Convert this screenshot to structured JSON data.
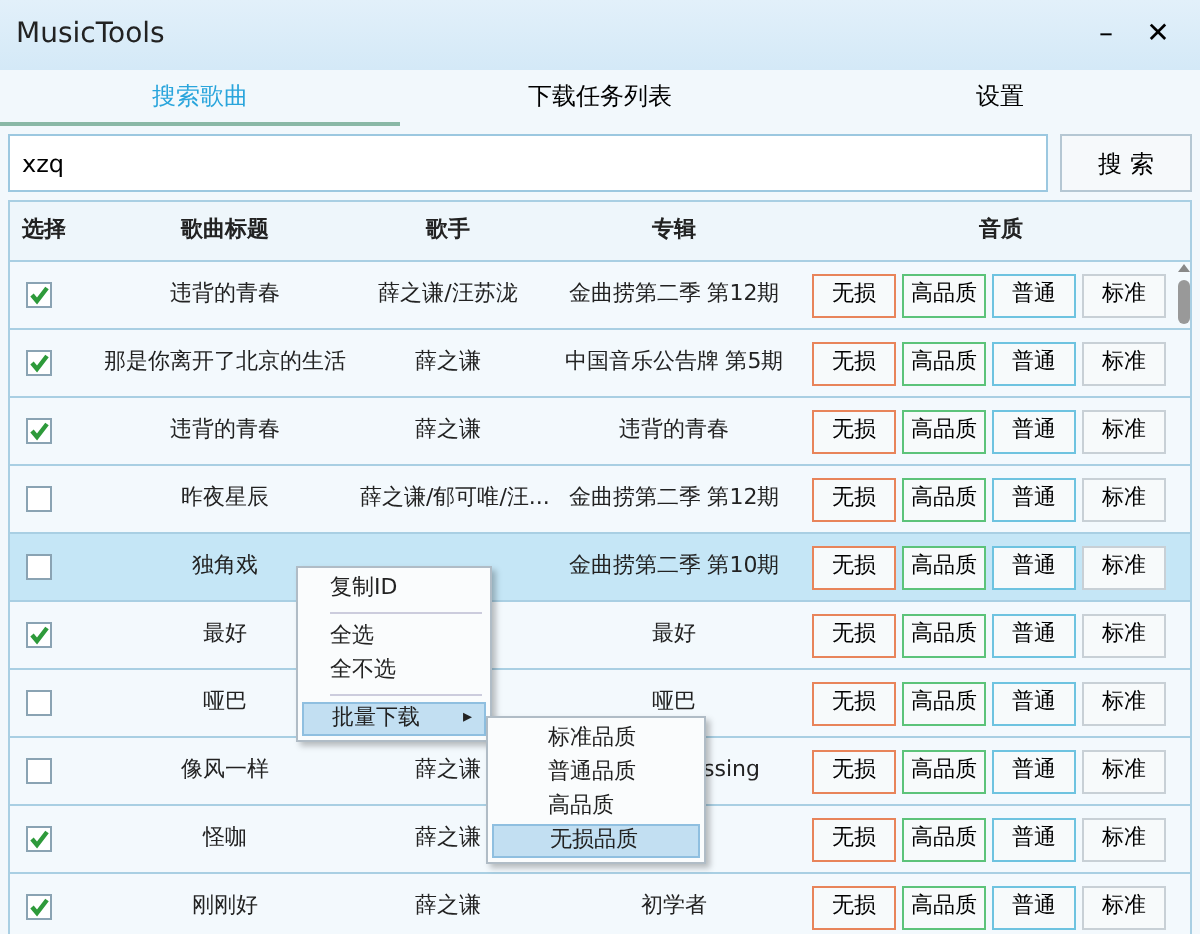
{
  "window": {
    "title": "MusicTools",
    "controls": [
      "–",
      "✕"
    ]
  },
  "tabs": [
    {
      "label": "搜索歌曲",
      "selected": true
    },
    {
      "label": "下载任务列表",
      "selected": false
    },
    {
      "label": "设置",
      "selected": false
    }
  ],
  "search": {
    "value": "xzq",
    "button": "搜 索"
  },
  "table": {
    "columns": [
      "选择",
      "歌曲标题",
      "歌手",
      "专辑",
      "音质"
    ],
    "rows": [
      {
        "kind": "full",
        "checked": true,
        "selected": false,
        "title": "违背的青春",
        "artist": "薛之谦/汪苏泷",
        "album": "金曲捞第二季 第12期",
        "quality": [
          {
            "label": "无损",
            "color": "#e8845a"
          },
          {
            "label": "高品质",
            "color": "#5cc37a"
          },
          {
            "label": "普通",
            "color": "#6ec3e0"
          },
          {
            "label": "标准",
            "color": "#c8d0d6"
          }
        ]
      },
      {
        "kind": "full",
        "checked": true,
        "selected": false,
        "title": "那是你离开了北京的生活",
        "artist": "薛之谦",
        "album": "中国音乐公告牌 第5期",
        "quality": [
          {
            "label": "无损",
            "color": "#e8845a"
          },
          {
            "label": "高品质",
            "color": "#5cc37a"
          },
          {
            "label": "普通",
            "color": "#6ec3e0"
          },
          {
            "label": "标准",
            "color": "#c8d0d6"
          }
        ]
      },
      {
        "kind": "full",
        "checked": true,
        "selected": false,
        "title": "违背的青春",
        "artist": "薛之谦",
        "album": "违背的青春",
        "quality": [
          {
            "label": "无损",
            "color": "#e8845a"
          },
          {
            "label": "高品质",
            "color": "#5cc37a"
          },
          {
            "label": "普通",
            "color": "#6ec3e0"
          },
          {
            "label": "标准",
            "color": "#c8d0d6"
          }
        ]
      },
      {
        "kind": "full",
        "checked": false,
        "selected": false,
        "title": "昨夜星辰",
        "artist": "薛之谦/郁可唯/汪...",
        "album": "金曲捞第二季 第12期",
        "quality": [
          {
            "label": "无损",
            "color": "#e8845a"
          },
          {
            "label": "高品质",
            "color": "#5cc37a"
          },
          {
            "label": "普通",
            "color": "#6ec3e0"
          },
          {
            "label": "标准",
            "color": "#c8d0d6"
          }
        ]
      },
      {
        "kind": "full",
        "checked": false,
        "selected": true,
        "title": "独角戏",
        "album": "金曲捞第二季 第10期",
        "quality": [
          {
            "label": "无损",
            "color": "#e8845a"
          },
          {
            "label": "高品质",
            "color": "#5cc37a"
          },
          {
            "label": "普通",
            "color": "#6ec3e0"
          },
          {
            "label": "标准",
            "color": "#c8d0d6"
          }
        ]
      },
      {
        "kind": "full",
        "checked": true,
        "selected": false,
        "title": "最好",
        "album": "最好",
        "quality": [
          {
            "label": "无损",
            "color": "#e8845a"
          },
          {
            "label": "高品质",
            "color": "#5cc37a"
          },
          {
            "label": "普通",
            "color": "#6ec3e0"
          },
          {
            "label": "标准",
            "color": "#c8d0d6"
          }
        ]
      },
      {
        "kind": "full",
        "checked": false,
        "selected": false,
        "title": "哑巴",
        "album": "哑巴",
        "quality": [
          {
            "label": "无损",
            "color": "#e8845a"
          },
          {
            "label": "高品质",
            "color": "#5cc37a"
          },
          {
            "label": "普通",
            "color": "#6ec3e0"
          },
          {
            "label": "标准",
            "color": "#c8d0d6"
          }
        ]
      },
      {
        "kind": "covered",
        "checked": false,
        "selected": false,
        "title": "像风一样",
        "artist": "薛之谦",
        "album": "ssing",
        "quality": [
          {
            "label": "无损",
            "color": "#e8845a"
          },
          {
            "label": "高品质",
            "color": "#5cc37a"
          },
          {
            "label": "普通",
            "color": "#6ec3e0"
          },
          {
            "label": "标准",
            "color": "#c8d0d6"
          }
        ]
      },
      {
        "kind": "full",
        "checked": true,
        "selected": false,
        "title": "怪咖",
        "artist": "薛之谦",
        "quality": [
          {
            "label": "无损",
            "color": "#e8845a"
          },
          {
            "label": "高品质",
            "color": "#5cc37a"
          },
          {
            "label": "普通",
            "color": "#6ec3e0"
          },
          {
            "label": "标准",
            "color": "#c8d0d6"
          }
        ]
      },
      {
        "kind": "full",
        "checked": true,
        "selected": false,
        "title": "刚刚好",
        "artist": "薛之谦",
        "album": "初学者",
        "quality": [
          {
            "label": "无损",
            "color": "#e8845a"
          },
          {
            "label": "高品质",
            "color": "#5cc37a"
          },
          {
            "label": "普通",
            "color": "#6ec3e0"
          },
          {
            "label": "标准",
            "color": "#c8d0d6"
          }
        ]
      }
    ]
  },
  "context_menu": {
    "items": [
      {
        "kind": "item",
        "label": "复制ID",
        "selected": false
      },
      {
        "kind": "separator"
      },
      {
        "kind": "item",
        "label": "全选",
        "selected": false
      },
      {
        "kind": "item",
        "label": "全不选",
        "selected": false
      },
      {
        "kind": "separator"
      },
      {
        "kind": "submenu",
        "label": "批量下载",
        "arrow": "▸",
        "selected": true
      }
    ],
    "submenu": [
      {
        "label": "标准品质",
        "selected": false
      },
      {
        "label": "普通品质",
        "selected": false
      },
      {
        "label": "高品质",
        "selected": false
      },
      {
        "label": "无损品质",
        "selected": true
      }
    ]
  }
}
